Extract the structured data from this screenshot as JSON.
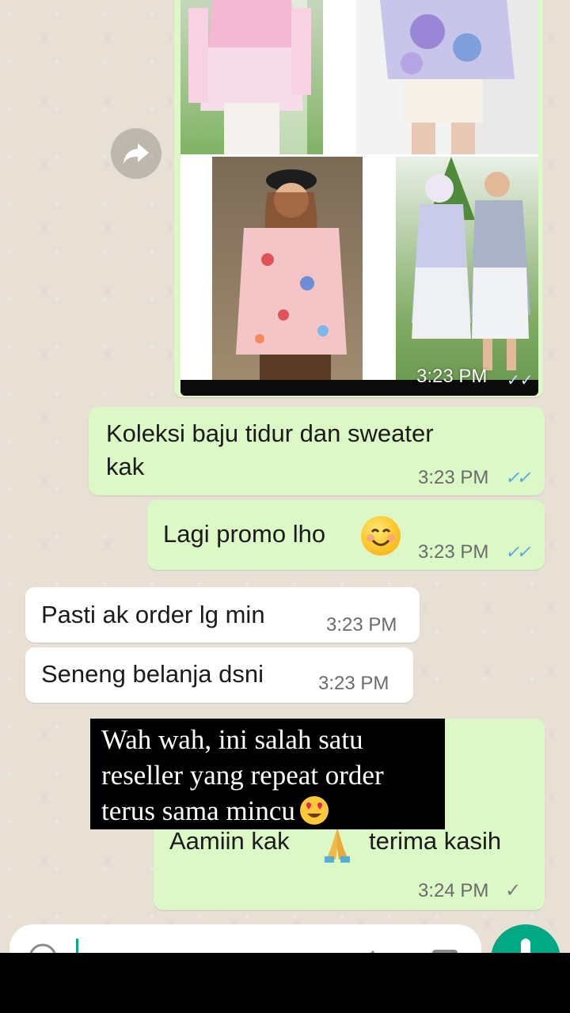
{
  "image_message": {
    "time": "3:23 PM",
    "status": "read",
    "photos": [
      {
        "subject": "pink ombre tunic"
      },
      {
        "subject": "purple tie-dye shirt"
      },
      {
        "subject": "pink patterned oversized shirt"
      },
      {
        "subject": "lilac ombre long tunic"
      }
    ]
  },
  "forward_button": {
    "icon": "share-forward-icon"
  },
  "messages": [
    {
      "direction": "out",
      "text_line1": "Koleksi baju tidur dan sweater",
      "text_line2": "kak",
      "time": "3:23 PM",
      "status": "read"
    },
    {
      "direction": "out",
      "text": "Lagi promo lho",
      "emoji": "smiling-face-icon",
      "time": "3:23 PM",
      "status": "read"
    },
    {
      "direction": "in",
      "text": "Pasti ak order lg min",
      "time": "3:23 PM"
    },
    {
      "direction": "in",
      "text": "Seneng belanja dsni",
      "time": "3:23 PM"
    },
    {
      "direction": "out",
      "text_before": "Aamiin kak",
      "emoji": "folded-hands-icon",
      "text_after": "terima kasih",
      "time": "3:24 PM",
      "status": "sent"
    }
  ],
  "caption_overlay": {
    "line1": "Wah wah, ini salah satu",
    "line2": "reseller yang repeat order",
    "line3": "terus sama mincu",
    "emoji": "heart-eyes-icon"
  },
  "input_bar": {
    "icons": [
      "emoji-icon",
      "attach-icon",
      "camera-icon"
    ],
    "send_icon": "mic-icon"
  },
  "colors": {
    "outgoing_bubble": "#dcf8c6",
    "incoming_bubble": "#ffffff",
    "read_ticks": "#4fa9e8",
    "wallpaper": "#e8e0d5",
    "accent": "#00a884"
  }
}
